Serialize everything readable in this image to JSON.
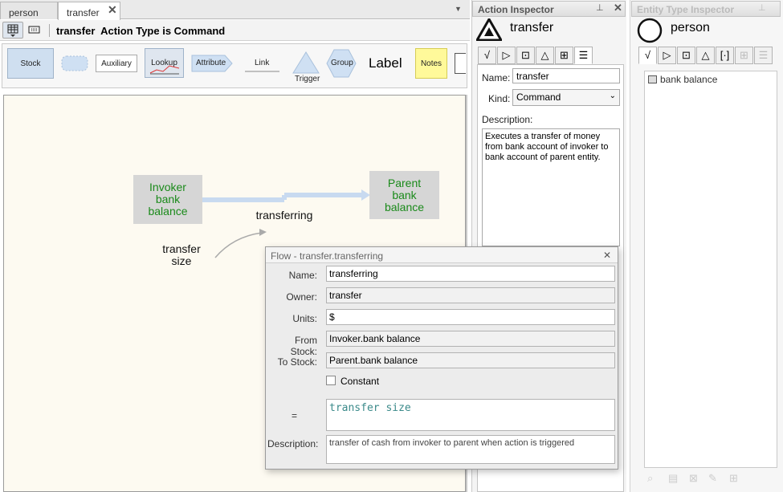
{
  "tabs": [
    {
      "label": "person",
      "active": false
    },
    {
      "label": "transfer",
      "active": true
    }
  ],
  "toolbar": {
    "title_name": "transfer",
    "title_rest": "Action Type is Command"
  },
  "palette": {
    "stock": "Stock",
    "auxiliary": "Auxiliary",
    "lookup": "Lookup",
    "attribute": "Attribute",
    "link": "Link",
    "trigger": "Trigger",
    "group": "Group",
    "label": "Label",
    "notes": "Notes"
  },
  "canvas": {
    "invoker_stock": "Invoker bank balance",
    "parent_stock": "Parent bank balance",
    "flow_label": "transferring",
    "aux_label": "transfer size"
  },
  "action_inspector": {
    "header": "Action Inspector",
    "name_title": "transfer",
    "name_label": "Name:",
    "name_value": "transfer",
    "kind_label": "Kind:",
    "kind_value": "Command",
    "description_label": "Description:",
    "description_value": "Executes a transfer of money from bank account of invoker to bank account of parent entity."
  },
  "entity_inspector": {
    "header": "Entity Type Inspector",
    "name_title": "person",
    "items": [
      "bank balance"
    ]
  },
  "flow_dialog": {
    "title": "Flow - transfer.transferring",
    "name_label": "Name:",
    "name_value": "transferring",
    "owner_label": "Owner:",
    "owner_value": "transfer",
    "units_label": "Units:",
    "units_value": "$",
    "from_label": "From Stock:",
    "from_value": "Invoker.bank balance",
    "to_label": "To Stock:",
    "to_value": "Parent.bank balance",
    "constant_label": "Constant",
    "equals_label": "=",
    "equation_value": "transfer size",
    "description_label": "Description:",
    "description_value": "transfer of cash from invoker to parent when action is triggered"
  }
}
